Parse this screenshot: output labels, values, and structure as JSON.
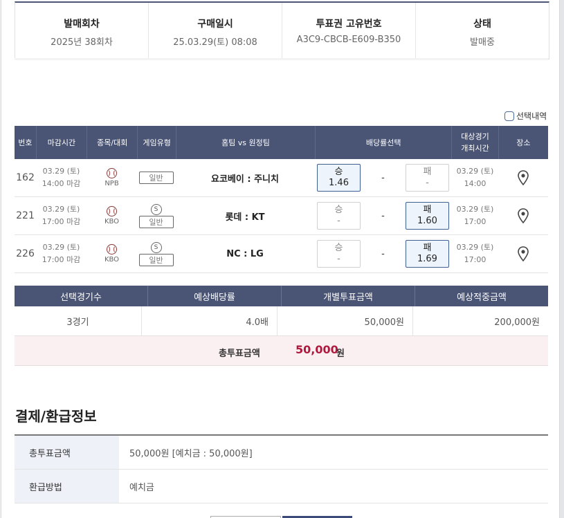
{
  "info": {
    "columns": [
      {
        "label": "발매회차",
        "value": "2025년 38회차"
      },
      {
        "label": "구매일시",
        "value": "25.03.29(토) 08:08"
      },
      {
        "label": "투표권 고유번호",
        "value": "A3C9-CBCB-E609-B350"
      },
      {
        "label": "상태",
        "value": "발매중"
      }
    ]
  },
  "selection_toggle": {
    "label": "선택내역",
    "checked": false
  },
  "match_table": {
    "headers": {
      "no": "번호",
      "deadline": "마감시간",
      "sport": "종목/대회",
      "game_type": "게임유형",
      "teams": "홈팀 vs 원정팀",
      "odds": "배당률선택",
      "time_line1": "대상경기",
      "time_line2": "개최시간",
      "place": "장소"
    },
    "rows": [
      {
        "no": "162",
        "deadline_date": "03.29 (토)",
        "deadline_time": "14:00 마감",
        "league": "NPB",
        "special": "",
        "game_type": "일반",
        "teams": "요코베이 : 주니치",
        "win_label": "승",
        "win_odds": "1.46",
        "draw": "-",
        "lose_label": "패",
        "lose_odds": "-",
        "selected": "win",
        "event_date": "03.29 (토)",
        "event_time": "14:00"
      },
      {
        "no": "221",
        "deadline_date": "03.29 (토)",
        "deadline_time": "17:00 마감",
        "league": "KBO",
        "special": "S",
        "game_type": "일반",
        "teams": "롯데 : KT",
        "win_label": "승",
        "win_odds": "-",
        "draw": "-",
        "lose_label": "패",
        "lose_odds": "1.60",
        "selected": "lose",
        "event_date": "03.29 (토)",
        "event_time": "17:00"
      },
      {
        "no": "226",
        "deadline_date": "03.29 (토)",
        "deadline_time": "17:00 마감",
        "league": "KBO",
        "special": "S",
        "game_type": "일반",
        "teams": "NC : LG",
        "win_label": "승",
        "win_odds": "-",
        "draw": "-",
        "lose_label": "패",
        "lose_odds": "1.69",
        "selected": "lose",
        "event_date": "03.29 (토)",
        "event_time": "17:00"
      }
    ]
  },
  "summary": {
    "headers": [
      "선택경기수",
      "예상배당률",
      "개별투표금액",
      "예상적중금액"
    ],
    "values": [
      "3경기",
      "4.0배",
      "50,000원",
      "200,000원"
    ],
    "total_label": "총투표금액",
    "total_value": "50,000",
    "total_unit": "원"
  },
  "refund": {
    "title": "결제/환급정보",
    "rows": [
      {
        "key": "총투표금액",
        "value": "50,000원 [예치금 : 50,000원]"
      },
      {
        "key": "환급방법",
        "value": "예치금"
      }
    ]
  },
  "colors": {
    "header_bg": "#4a5474",
    "accent_red": "#b0193e",
    "selected_border": "#3d5f92"
  }
}
